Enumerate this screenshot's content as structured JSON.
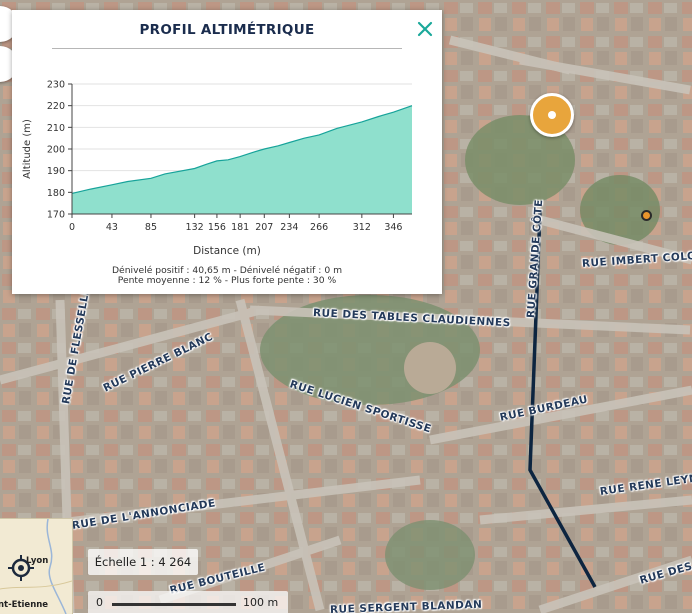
{
  "profile": {
    "title": "PROFIL ALTIMÉTRIQUE",
    "close_icon": "close-icon",
    "accent_color": "#1aa89a",
    "stats_line1": "Dénivelé positif : 40,65 m - Dénivelé négatif : 0 m",
    "stats_line2": "Pente moyenne : 12 % - Plus forte pente : 30 %"
  },
  "chart_data": {
    "type": "area",
    "xlabel": "Distance (m)",
    "ylabel": "Altitude (m)",
    "x_ticks": [
      "0",
      "43",
      "85",
      "132",
      "156",
      "181",
      "207",
      "234",
      "266",
      "312",
      "346"
    ],
    "y_ticks": [
      "170",
      "180",
      "190",
      "200",
      "210",
      "220",
      "230"
    ],
    "ylim": [
      170,
      230
    ],
    "xlim": [
      0,
      366
    ],
    "fill_color": "#8fe0cd",
    "line_color": "#17a39a",
    "x": [
      0,
      20,
      43,
      60,
      85,
      100,
      132,
      145,
      156,
      168,
      181,
      195,
      207,
      222,
      234,
      250,
      266,
      285,
      312,
      330,
      346,
      366
    ],
    "y": [
      179.5,
      181.5,
      183.5,
      185,
      186.5,
      188.5,
      191,
      193,
      194.5,
      195,
      196.5,
      198.5,
      200,
      201.5,
      203,
      205,
      206.5,
      209.5,
      212.5,
      215,
      217,
      220
    ]
  },
  "map": {
    "streets": [
      "RUE DES TABLES CLAUDIENNES",
      "RUE PIERRE BLANC",
      "RUE LUCIEN SPORTISSE",
      "RUE BURDEAU",
      "RUE IMBERT COLO",
      "RUE DE FLESSELLES",
      "RUE DE L'ANNONCIADE",
      "RUE BOUTEILLE",
      "RUE RENE LEYNA",
      "RUE DES CAP",
      "RUE SERGENT BLANDAN",
      "RUE GRANDE CÔTE"
    ],
    "route_color": "#0d2540",
    "position_marker_icon": "location-marker-icon",
    "poi_marker_icon": "poi-marker-icon"
  },
  "minimap": {
    "labels": [
      "Lyon",
      "nt-Etienne"
    ],
    "locate_icon": "crosshair-target-icon"
  },
  "scale": {
    "label": "Échelle 1 : 4 264",
    "bar_start": "0",
    "bar_end": "100 m"
  }
}
